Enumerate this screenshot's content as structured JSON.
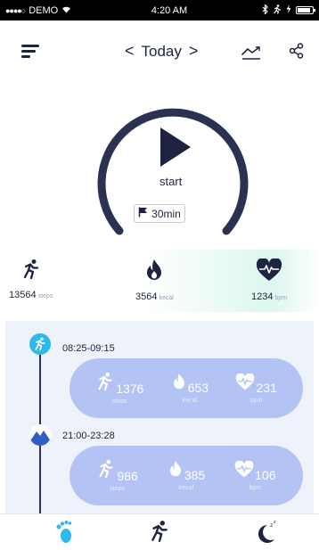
{
  "status": {
    "carrier": "DEMO",
    "time": "4:20 AM"
  },
  "header": {
    "date_label": "Today",
    "prev": "<",
    "next": ">"
  },
  "workout": {
    "start_label": "start",
    "duration": "30min"
  },
  "stats": [
    {
      "value": "13564",
      "unit": "steps",
      "icon": "running-icon"
    },
    {
      "value": "3564",
      "unit": "kecal",
      "icon": "flame-icon"
    },
    {
      "value": "1234",
      "unit": "bpm",
      "icon": "heart-rate-icon"
    }
  ],
  "sessions": [
    {
      "time": "08:25-09:15",
      "icon": "running-icon",
      "metrics": [
        {
          "value": "1376",
          "label": "steps"
        },
        {
          "value": "653",
          "label": "kecal"
        },
        {
          "value": "231",
          "label": "bpm"
        }
      ]
    },
    {
      "time": "21:00-23:28",
      "icon": "mountain-icon",
      "metrics": [
        {
          "value": "986",
          "label": "steps"
        },
        {
          "value": "385",
          "label": "kecal"
        },
        {
          "value": "106",
          "label": "bpm"
        }
      ]
    }
  ],
  "bottom_nav": [
    {
      "name": "footprint-icon",
      "active": true
    },
    {
      "name": "running-icon",
      "active": false
    },
    {
      "name": "sleep-moon-icon",
      "active": false
    }
  ],
  "colors": {
    "accent": "#2fb8ea",
    "navy": "#1d2340",
    "card": "#b3c3f3",
    "panel": "#eef3fb"
  }
}
